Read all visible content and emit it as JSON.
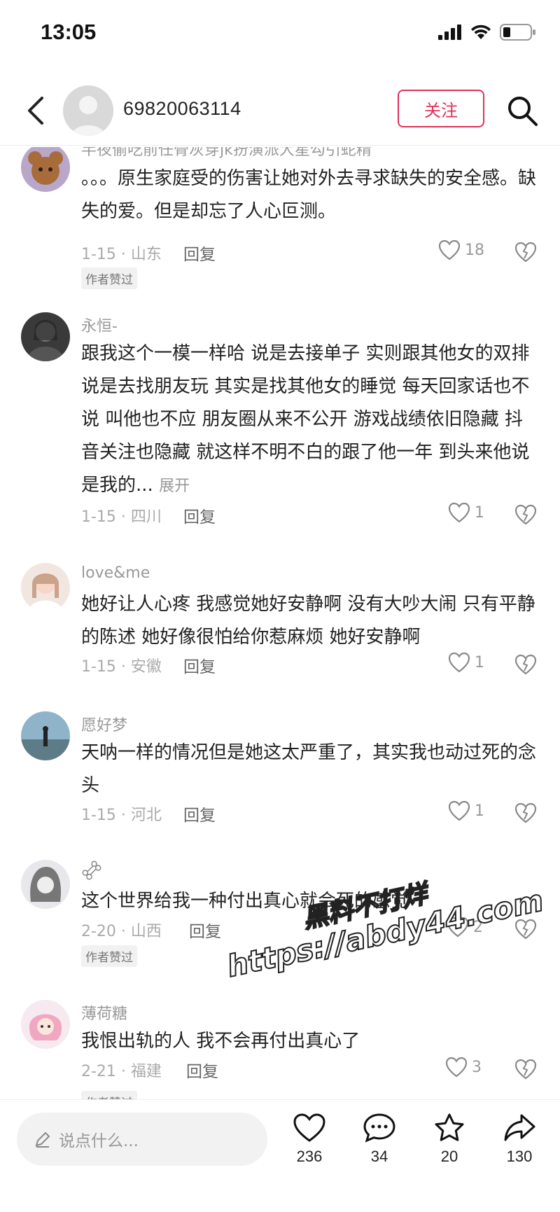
{
  "status": {
    "time": "13:05"
  },
  "header": {
    "username": "69820063114",
    "follow_label": "关注"
  },
  "comments": [
    {
      "name": "半夜偷吃前任骨灰穿jk扮演派大星勾引蛇精",
      "text": "。。。原生家庭受的伤害让她对外去寻求缺失的安全感。缺失的爱。但是却忘了人心叵测。",
      "expand": "",
      "meta": "1-15 · 山东",
      "reply": "回复",
      "likes": "18",
      "badge": "作者赞过"
    },
    {
      "name": "永恒-",
      "text": "跟我这个一模一样哈 说是去接单子 实则跟其他女的双排  说是去找朋友玩 其实是找其他女的睡觉  每天回家话也不说 叫他也不应 朋友圈从来不公开 游戏战绩依旧隐藏 抖音关注也隐藏 就这样不明不白的跟了他一年 到头来他说是我的...",
      "expand": "展开",
      "meta": "1-15 · 四川",
      "reply": "回复",
      "likes": "1",
      "badge": ""
    },
    {
      "name": "love&me",
      "text": "她好让人心疼 我感觉她好安静啊 没有大吵大闹 只有平静的陈述 她好像很怕给你惹麻烦  她好安静啊",
      "expand": "",
      "meta": "1-15 · 安徽",
      "reply": "回复",
      "likes": "1",
      "badge": ""
    },
    {
      "name": "愿好梦",
      "text": "天呐一样的情况但是她这太严重了，其实我也动过死的念头",
      "expand": "",
      "meta": "1-15 · 河北",
      "reply": "回复",
      "likes": "1",
      "badge": ""
    },
    {
      "name": "",
      "text": "这个世界给我一种付出真心就会死的感觉",
      "expand": "",
      "meta": "2-20 · 山西",
      "reply": "回复",
      "likes": "2",
      "badge": "作者赞过"
    },
    {
      "name": "薄荷糖",
      "text": "我恨出轨的人 我不会再付出真心了",
      "expand": "",
      "meta": "2-21 · 福建",
      "reply": "回复",
      "likes": "3",
      "badge": "作者赞过"
    }
  ],
  "watermark": {
    "line1": "黑料不打烊",
    "line2": "https://abdy44.com"
  },
  "bottom": {
    "placeholder": "说点什么...",
    "likes": "236",
    "comments": "34",
    "favorites": "20",
    "shares": "130"
  }
}
